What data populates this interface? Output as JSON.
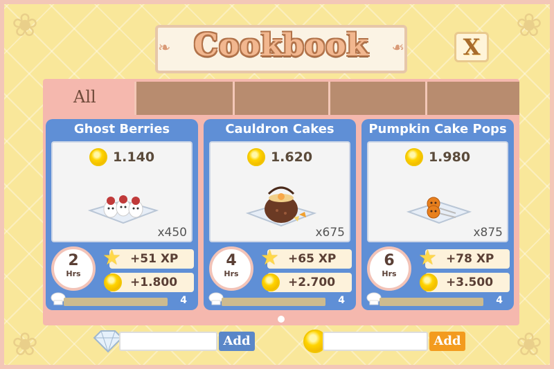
{
  "header": {
    "title": "Cookbook",
    "close_label": "X"
  },
  "tabs": [
    {
      "label": "All"
    },
    {
      "label": ""
    },
    {
      "label": ""
    },
    {
      "label": ""
    },
    {
      "label": ""
    }
  ],
  "recipes": [
    {
      "name": "Ghost Berries",
      "price": "1.140",
      "quantity": "x450",
      "time": "2",
      "time_unit": "Hrs",
      "xp": "+51 XP",
      "coins": "+1.800",
      "level": "4",
      "progress": 0.0
    },
    {
      "name": "Cauldron Cakes",
      "price": "1.620",
      "quantity": "x675",
      "time": "4",
      "time_unit": "Hrs",
      "xp": "+65 XP",
      "coins": "+2.700",
      "level": "4",
      "progress": 0.0
    },
    {
      "name": "Pumpkin Cake Pops",
      "price": "1.980",
      "quantity": "x875",
      "time": "6",
      "time_unit": "Hrs",
      "xp": "+78 XP",
      "coins": "+3.500",
      "level": "4",
      "progress": 0.0
    }
  ],
  "currency": {
    "gems": {
      "value": "",
      "add_label": "Add",
      "color": "#5a87c8"
    },
    "coins": {
      "value": "",
      "add_label": "Add",
      "color": "#f39b1e"
    }
  },
  "colors": {
    "background": "#f9e79a",
    "panel": "#f5b8ae",
    "card": "#5f8fd6",
    "tab_empty": "#b88c6f"
  }
}
